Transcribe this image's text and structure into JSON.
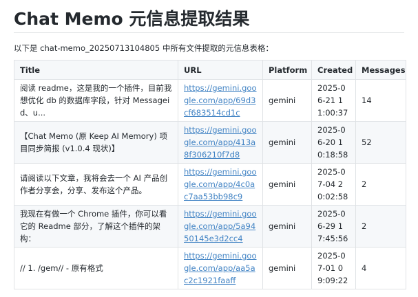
{
  "page": {
    "title": "Chat Memo 元信息提取结果",
    "intro": "以下是 chat-memo_20250713104805 中所有文件提取的元信息表格："
  },
  "table": {
    "headers": {
      "title": "Title",
      "url": "URL",
      "platform": "Platform",
      "created": "Created",
      "messages": "Messages"
    },
    "rows": [
      {
        "title": "阅读 readme，这是我的一个插件，目前我想优化 db 的数据库字段，针对 Messageid、u...",
        "url": "https://gemini.google.com/app/69d3cf683514cd1c",
        "platform": "gemini",
        "created": "2025-06-21 11:00:37",
        "messages": "14"
      },
      {
        "title": "【Chat Memo (原 Keep AI Memory) 项目同步简报 (v1.0.4 现状)】",
        "url": "https://gemini.google.com/app/413a8f306210f7d8",
        "platform": "gemini",
        "created": "2025-06-20 10:18:58",
        "messages": "52"
      },
      {
        "title": "请阅读以下文章，我将会去一个 AI 产品创作者分享会，分享、发布这个产品。",
        "url": "https://gemini.google.com/app/4c0ac7aa53bb98c9",
        "platform": "gemini",
        "created": "2025-07-04 20:02:58",
        "messages": "2"
      },
      {
        "title": "我现在有做一个 Chrome 插件，你可以看它的 Readme 部分，了解这个插件的架构：",
        "url": "https://gemini.google.com/app/5a9450145e3d2cc4",
        "platform": "gemini",
        "created": "2025-06-29 17:45:56",
        "messages": "2"
      },
      {
        "title": "// 1. /gem// - 原有格式",
        "url": "https://gemini.google.com/app/aa5ac2c1921faaff",
        "platform": "gemini",
        "created": "2025-07-01 09:09:22",
        "messages": "4"
      }
    ]
  },
  "colors": {
    "link": "#4183c4",
    "border": "#dfe2e5",
    "alt_row_background": "#f6f8fa",
    "text": "#24292e"
  }
}
